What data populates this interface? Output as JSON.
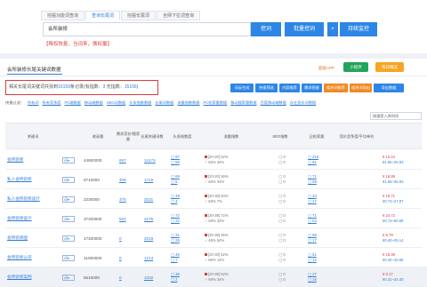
{
  "tabs": [
    "挖掘功能词查询",
    "查询长尾词",
    "挖掘长尾词",
    "全网下拉词查询"
  ],
  "search": {
    "value": "会所装修",
    "mine_btn": "挖词",
    "batch_btn": "批量挖词",
    "monitor_btn": "持续监控",
    "plus": "+"
  },
  "hint": "【降权恢复，当词来，换权量】",
  "card": {
    "title": "会所装修长尾关键词数据",
    "pill1": "超级APP",
    "pill2": "小程序",
    "pill3": "每日精选",
    "stats_prefix": "相关长尾词关键词共找到",
    "stats_total": "15159",
    "stats_mid": "条记录(有指数：",
    "stats_idx": "3",
    "stats_mid2": " 无指数：",
    "stats_noidx": "15156",
    "stats_suffix": ")"
  },
  "tools": [
    {
      "label": "词云生成",
      "color": "#2d86e6"
    },
    {
      "label": "快速筛选",
      "color": "#2d86e6"
    },
    {
      "label": "内容推荐",
      "color": "#2d86e6"
    },
    {
      "label": "需求图谱",
      "color": "#2d86e6"
    },
    {
      "label": "相关词推荐",
      "color": "#f08a24"
    },
    {
      "label": "相关词导出",
      "color": "#f08a24"
    },
    {
      "label": "导出数据",
      "color": "#2d86e6"
    }
  ],
  "filters": [
    "快捷过滤：",
    "所有词",
    "所有竞争度",
    "PC端数据",
    "移动端数据",
    "SEO词数据",
    "头条指数数据",
    "长尾词数据",
    "流量指数数据",
    "PC检索量数据",
    "移动搜索量数据",
    "百度移动端数据",
    "存在竞价词数据"
  ],
  "sort_placeholder": "按搜索入库时间",
  "headers": [
    "关键词",
    "",
    "收录量",
    "需求竞价/搜索量",
    "长尾关键词数",
    "头条指数度",
    "流量指数",
    "SEO指数",
    "日检索量",
    "竞价竞争度/平均单价"
  ],
  "rows": [
    {
      "kw": "会所装修",
      "vol": "44800000",
      "n1": "657",
      "n2": "14174",
      "a": "97",
      "b": "56",
      "f1": "[20-20] 52%",
      "f2": "66%  34%",
      "seo": "0",
      "d1": "216",
      "d2": "81",
      "price": "¥ 10.24",
      "range": "¥1.95~26.93"
    },
    {
      "kw": "私人会所装修",
      "vol": "6710000",
      "n1": "409",
      "n2": "1715",
      "a": "69",
      "b": "5",
      "f1": "[20-20] 56%",
      "f2": "66%  34%",
      "seo": "0",
      "d1": "71",
      "d2": "98",
      "price": "¥ 18.88",
      "range": "¥1.65~36.93"
    },
    {
      "kw": "私人会所装修设计",
      "vol": "2230000",
      "n1": "375",
      "n2": "2031",
      "a": "49",
      "b": "4",
      "f1": "[20-30] 84%",
      "f2": "93%  7%",
      "seo": "0",
      "d1": "33",
      "d2": "47",
      "price": "¥ 19.71",
      "range": "¥0.73~27.87"
    },
    {
      "kw": "会所装修设计",
      "vol": "37400000",
      "n1": "522",
      "n2": "2275",
      "a": "72",
      "b": "22",
      "f1": "[30-39] 72%",
      "f2": "68%  32%",
      "seo": "0",
      "d1": "71",
      "d2": "53",
      "price": "¥ 24.72",
      "range": "¥0.73~60.68"
    },
    {
      "kw": "会所装修图",
      "vol": "17400000",
      "n1": "0",
      "n2": "2019",
      "a": "31",
      "b": "28",
      "f1": "[30-39] 65%",
      "f2": "46%  54%",
      "seo": "0",
      "d1": "68",
      "d2": "17",
      "price": "¥ 8.79",
      "range": "¥0.40~25.14"
    },
    {
      "kw": "会所装修公司",
      "vol": "31900000",
      "n1": "0",
      "n2": "1213",
      "a": "46",
      "b": "7",
      "f1": "[20-30] 52%",
      "f2": "86%  14%",
      "seo": "0",
      "d1": "51",
      "d2": "12",
      "price": "¥ 15.39",
      "range": "¥0.34~15.68"
    },
    {
      "kw": "会所装修案例",
      "vol": "5510000",
      "n1": "0",
      "n2": "1032",
      "a": "36",
      "b": "2",
      "f1": "[20-39] 52%",
      "f2": "66%  34%",
      "seo": "0",
      "d1": "27",
      "d2": "16",
      "price": "¥ 6.17",
      "range": "¥0.31~24.40"
    }
  ]
}
